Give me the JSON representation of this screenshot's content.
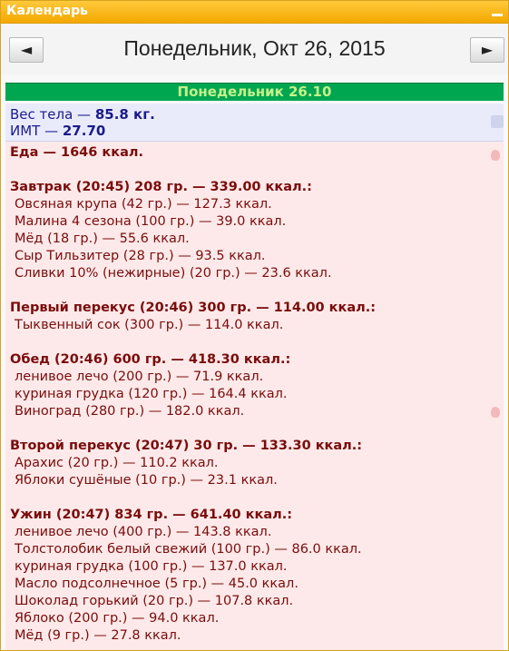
{
  "window": {
    "title": "Календарь"
  },
  "nav": {
    "prev_label": "◄",
    "next_label": "►",
    "date_title": "Понедельник, Окт 26, 2015"
  },
  "day_header": "Понедельник 26.10",
  "body": {
    "weight_label": "Вес тела — ",
    "weight_value": "85.8 кг.",
    "bmi_label": "ИМТ — ",
    "bmi_value": "27.70"
  },
  "food_total": "Еда — 1646 ккал.",
  "meals": [
    {
      "heading": "Завтрак (20:45) 208 гр. — 339.00 ккал.:",
      "items": [
        "Овсяная крупа (42 гр.) — 127.3 ккал.",
        "Малина 4 сезона (100 гр.) — 39.0 ккал.",
        "Мёд (18 гр.) — 55.6 ккал.",
        "Сыр Тильзитер (28 гр.) — 93.5 ккал.",
        "Сливки 10% (нежирные) (20 гр.) — 23.6 ккал."
      ]
    },
    {
      "heading": "Первый перекус (20:46) 300 гр. — 114.00 ккал.:",
      "items": [
        "Тыквенный сок (300 гр.) — 114.0 ккал."
      ]
    },
    {
      "heading": "Обед (20:46) 600 гр. — 418.30 ккал.:",
      "items": [
        "ленивое лечо (200 гр.) — 71.9 ккал.",
        "куриная грудка (120 гр.) — 164.4 ккал.",
        "Виноград (280 гр.) — 182.0 ккал."
      ]
    },
    {
      "heading": "Второй перекус (20:47) 30 гр. — 133.30 ккал.:",
      "items": [
        "Арахис (20 гр.) — 110.2 ккал.",
        "Яблоки сушёные (10 гр.) — 23.1 ккал."
      ]
    },
    {
      "heading": "Ужин (20:47) 834 гр. — 641.40 ккал.:",
      "items": [
        "ленивое лечо (400 гр.) — 143.8 ккал.",
        "Толстолобик белый свежий (100 гр.) — 86.0 ккал.",
        "куриная грудка (100 гр.) — 137.0 ккал.",
        "Масло подсолнечное (5 гр.) — 45.0 ккал.",
        "Шоколад горький (20 гр.) — 107.8 ккал.",
        "Яблоко (200 гр.) — 94.0 ккал.",
        "Мёд (9 гр.) — 27.8 ккал."
      ]
    }
  ]
}
